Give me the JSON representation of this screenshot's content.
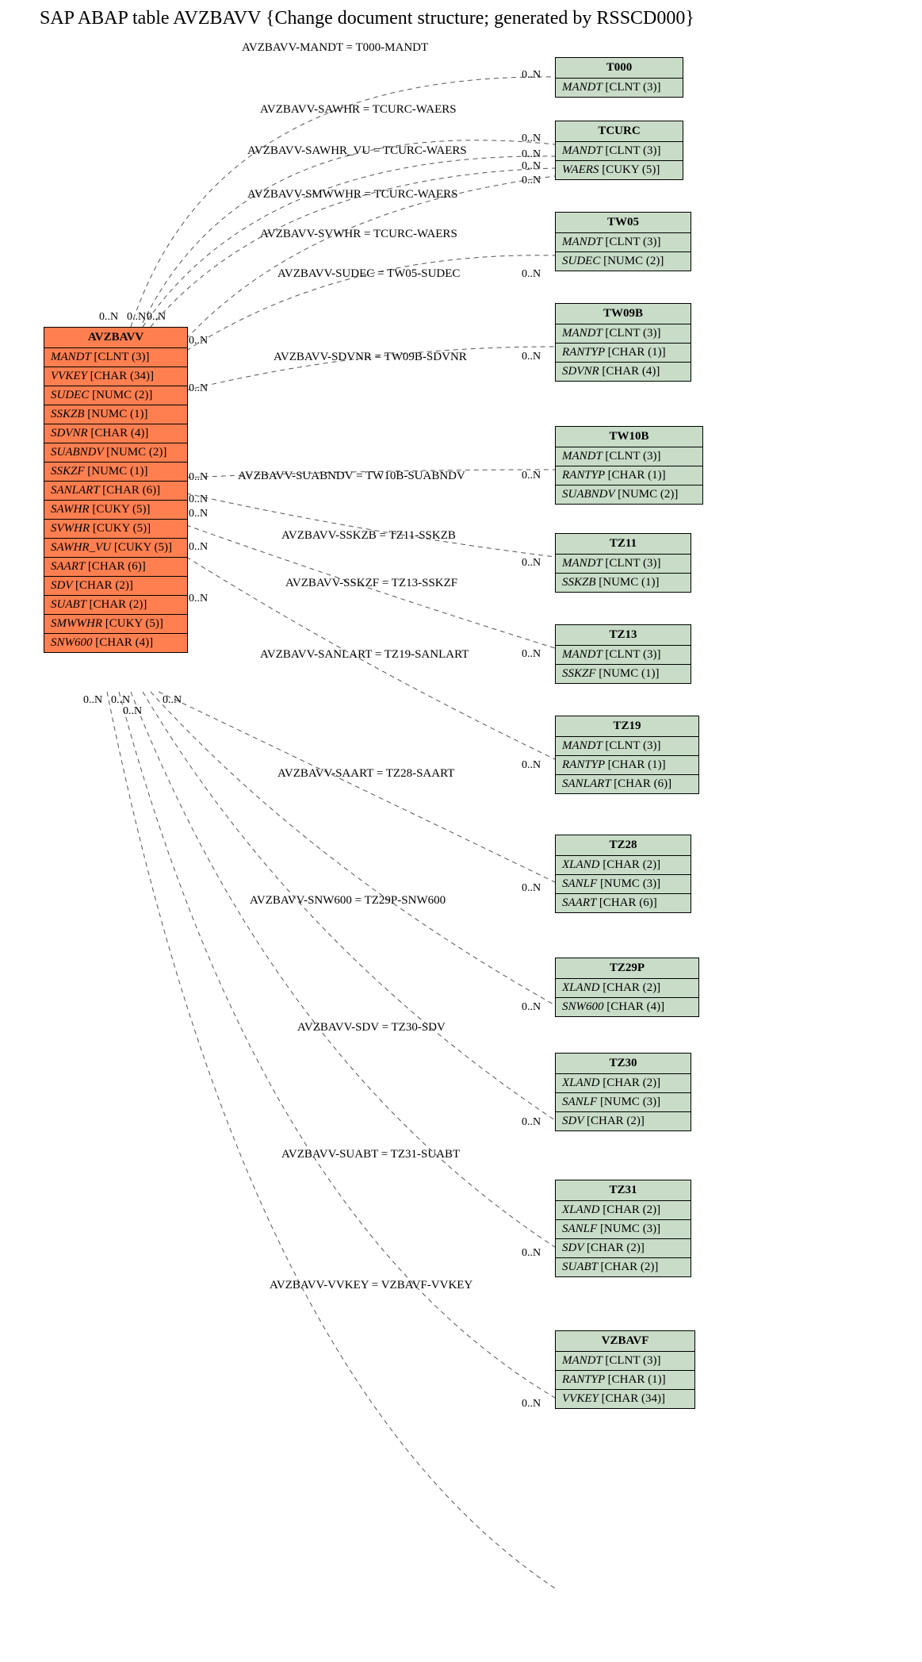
{
  "title": "SAP ABAP table AVZBAVV {Change document structure; generated by RSSCD000}",
  "main": {
    "name": "AVZBAVV",
    "fields": [
      {
        "n": "MANDT",
        "t": "[CLNT (3)]"
      },
      {
        "n": "VVKEY",
        "t": "[CHAR (34)]"
      },
      {
        "n": "SUDEC",
        "t": "[NUMC (2)]"
      },
      {
        "n": "SSKZB",
        "t": "[NUMC (1)]"
      },
      {
        "n": "SDVNR",
        "t": "[CHAR (4)]"
      },
      {
        "n": "SUABNDV",
        "t": "[NUMC (2)]"
      },
      {
        "n": "SSKZF",
        "t": "[NUMC (1)]"
      },
      {
        "n": "SANLART",
        "t": "[CHAR (6)]"
      },
      {
        "n": "SAWHR",
        "t": "[CUKY (5)]"
      },
      {
        "n": "SVWHR",
        "t": "[CUKY (5)]"
      },
      {
        "n": "SAWHR_VU",
        "t": "[CUKY (5)]"
      },
      {
        "n": "SAART",
        "t": "[CHAR (6)]"
      },
      {
        "n": "SDV",
        "t": "[CHAR (2)]"
      },
      {
        "n": "SUABT",
        "t": "[CHAR (2)]"
      },
      {
        "n": "SMWWHR",
        "t": "[CUKY (5)]"
      },
      {
        "n": "SNW600",
        "t": "[CHAR (4)]"
      }
    ]
  },
  "refs": [
    {
      "name": "T000",
      "fields": [
        {
          "n": "MANDT",
          "t": "[CLNT (3)]"
        }
      ]
    },
    {
      "name": "TCURC",
      "fields": [
        {
          "n": "MANDT",
          "t": "[CLNT (3)]"
        },
        {
          "n": "WAERS",
          "t": "[CUKY (5)]"
        }
      ]
    },
    {
      "name": "TW05",
      "fields": [
        {
          "n": "MANDT",
          "t": "[CLNT (3)]"
        },
        {
          "n": "SUDEC",
          "t": "[NUMC (2)]"
        }
      ]
    },
    {
      "name": "TW09B",
      "fields": [
        {
          "n": "MANDT",
          "t": "[CLNT (3)]"
        },
        {
          "n": "RANTYP",
          "t": "[CHAR (1)]"
        },
        {
          "n": "SDVNR",
          "t": "[CHAR (4)]"
        }
      ]
    },
    {
      "name": "TW10B",
      "fields": [
        {
          "n": "MANDT",
          "t": "[CLNT (3)]"
        },
        {
          "n": "RANTYP",
          "t": "[CHAR (1)]"
        },
        {
          "n": "SUABNDV",
          "t": "[NUMC (2)]"
        }
      ]
    },
    {
      "name": "TZ11",
      "fields": [
        {
          "n": "MANDT",
          "t": "[CLNT (3)]"
        },
        {
          "n": "SSKZB",
          "t": "[NUMC (1)]"
        }
      ]
    },
    {
      "name": "TZ13",
      "fields": [
        {
          "n": "MANDT",
          "t": "[CLNT (3)]"
        },
        {
          "n": "SSKZF",
          "t": "[NUMC (1)]"
        }
      ]
    },
    {
      "name": "TZ19",
      "fields": [
        {
          "n": "MANDT",
          "t": "[CLNT (3)]"
        },
        {
          "n": "RANTYP",
          "t": "[CHAR (1)]"
        },
        {
          "n": "SANLART",
          "t": "[CHAR (6)]"
        }
      ]
    },
    {
      "name": "TZ28",
      "fields": [
        {
          "n": "XLAND",
          "t": "[CHAR (2)]"
        },
        {
          "n": "SANLF",
          "t": "[NUMC (3)]"
        },
        {
          "n": "SAART",
          "t": "[CHAR (6)]"
        }
      ]
    },
    {
      "name": "TZ29P",
      "fields": [
        {
          "n": "XLAND",
          "t": "[CHAR (2)]"
        },
        {
          "n": "SNW600",
          "t": "[CHAR (4)]"
        }
      ]
    },
    {
      "name": "TZ30",
      "fields": [
        {
          "n": "XLAND",
          "t": "[CHAR (2)]"
        },
        {
          "n": "SANLF",
          "t": "[NUMC (3)]"
        },
        {
          "n": "SDV",
          "t": "[CHAR (2)]"
        }
      ]
    },
    {
      "name": "TZ31",
      "fields": [
        {
          "n": "XLAND",
          "t": "[CHAR (2)]"
        },
        {
          "n": "SANLF",
          "t": "[NUMC (3)]"
        },
        {
          "n": "SDV",
          "t": "[CHAR (2)]"
        },
        {
          "n": "SUABT",
          "t": "[CHAR (2)]"
        }
      ]
    },
    {
      "name": "VZBAVF",
      "fields": [
        {
          "n": "MANDT",
          "t": "[CLNT (3)]"
        },
        {
          "n": "RANTYP",
          "t": "[CHAR (1)]"
        },
        {
          "n": "VVKEY",
          "t": "[CHAR (34)]"
        }
      ]
    }
  ],
  "rels": [
    {
      "label": "AVZBAVV-MANDT = T000-MANDT"
    },
    {
      "label": "AVZBAVV-SAWHR = TCURC-WAERS"
    },
    {
      "label": "AVZBAVV-SAWHR_VU = TCURC-WAERS"
    },
    {
      "label": "AVZBAVV-SMWWHR = TCURC-WAERS"
    },
    {
      "label": "AVZBAVV-SVWHR = TCURC-WAERS"
    },
    {
      "label": "AVZBAVV-SUDEC = TW05-SUDEC"
    },
    {
      "label": "AVZBAVV-SDVNR = TW09B-SDVNR"
    },
    {
      "label": "AVZBAVV-SUABNDV = TW10B-SUABNDV"
    },
    {
      "label": "AVZBAVV-SSKZB = TZ11-SSKZB"
    },
    {
      "label": "AVZBAVV-SSKZF = TZ13-SSKZF"
    },
    {
      "label": "AVZBAVV-SANLART = TZ19-SANLART"
    },
    {
      "label": "AVZBAVV-SAART = TZ28-SAART"
    },
    {
      "label": "AVZBAVV-SNW600 = TZ29P-SNW600"
    },
    {
      "label": "AVZBAVV-SDV = TZ30-SDV"
    },
    {
      "label": "AVZBAVV-SUABT = TZ31-SUABT"
    },
    {
      "label": "AVZBAVV-VVKEY = VZBAVF-VVKEY"
    }
  ],
  "card": "0..N",
  "chart_data": {
    "type": "erd",
    "main_entity": "AVZBAVV",
    "description": "Change document structure; generated by RSSCD000",
    "relationships": [
      {
        "from": "AVZBAVV.MANDT",
        "to": "T000.MANDT",
        "card_from": "0..N",
        "card_to": "0..N"
      },
      {
        "from": "AVZBAVV.SAWHR",
        "to": "TCURC.WAERS",
        "card_from": "0..N",
        "card_to": "0..N"
      },
      {
        "from": "AVZBAVV.SAWHR_VU",
        "to": "TCURC.WAERS",
        "card_from": "0..N",
        "card_to": "0..N"
      },
      {
        "from": "AVZBAVV.SMWWHR",
        "to": "TCURC.WAERS",
        "card_from": "0..N",
        "card_to": "0..N"
      },
      {
        "from": "AVZBAVV.SVWHR",
        "to": "TCURC.WAERS",
        "card_from": "0..N",
        "card_to": "0..N"
      },
      {
        "from": "AVZBAVV.SUDEC",
        "to": "TW05.SUDEC",
        "card_from": "0..N",
        "card_to": "0..N"
      },
      {
        "from": "AVZBAVV.SDVNR",
        "to": "TW09B.SDVNR",
        "card_from": "0..N",
        "card_to": "0..N"
      },
      {
        "from": "AVZBAVV.SUABNDV",
        "to": "TW10B.SUABNDV",
        "card_from": "0..N",
        "card_to": "0..N"
      },
      {
        "from": "AVZBAVV.SSKZB",
        "to": "TZ11.SSKZB",
        "card_from": "0..N",
        "card_to": "0..N"
      },
      {
        "from": "AVZBAVV.SSKZF",
        "to": "TZ13.SSKZF",
        "card_from": "0..N",
        "card_to": "0..N"
      },
      {
        "from": "AVZBAVV.SANLART",
        "to": "TZ19.SANLART",
        "card_from": "0..N",
        "card_to": "0..N"
      },
      {
        "from": "AVZBAVV.SAART",
        "to": "TZ28.SAART",
        "card_from": "0..N",
        "card_to": "0..N"
      },
      {
        "from": "AVZBAVV.SNW600",
        "to": "TZ29P.SNW600",
        "card_from": "0..N",
        "card_to": "0..N"
      },
      {
        "from": "AVZBAVV.SDV",
        "to": "TZ30.SDV",
        "card_from": "0..N",
        "card_to": "0..N"
      },
      {
        "from": "AVZBAVV.SUABT",
        "to": "TZ31.SUABT",
        "card_from": "0..N",
        "card_to": "0..N"
      },
      {
        "from": "AVZBAVV.VVKEY",
        "to": "VZBAVF.VVKEY",
        "card_from": "0..N",
        "card_to": "0..N"
      }
    ]
  }
}
